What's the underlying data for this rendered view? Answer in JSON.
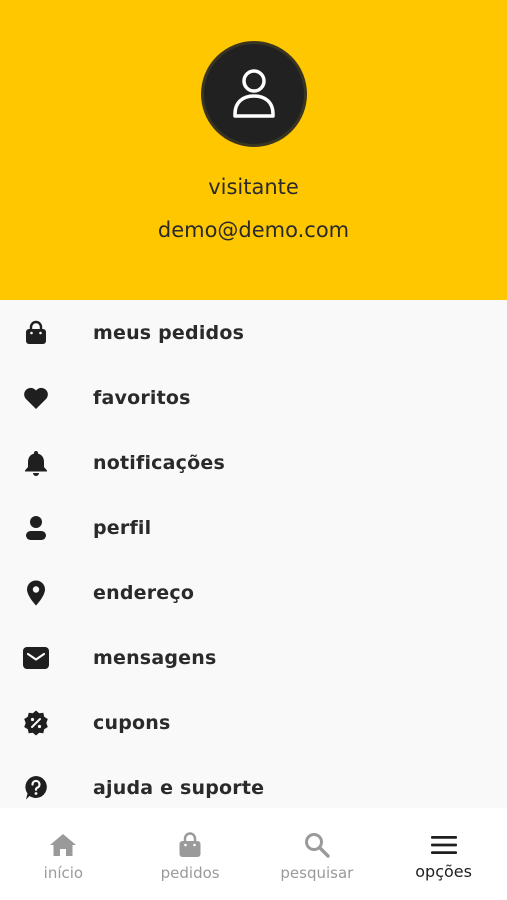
{
  "profile": {
    "name": "visitante",
    "email": "demo@demo.com"
  },
  "colors": {
    "header_bg": "#ffc700",
    "avatar_bg": "#212121",
    "text": "#2a2a2a",
    "nav_inactive": "#9a9a9a",
    "nav_active": "#1f1f1f"
  },
  "menu": {
    "items": [
      {
        "label": "meus pedidos",
        "icon": "shopping-bag-icon"
      },
      {
        "label": "favoritos",
        "icon": "heart-icon"
      },
      {
        "label": "notificações",
        "icon": "bell-icon"
      },
      {
        "label": "perfil",
        "icon": "person-icon"
      },
      {
        "label": "endereço",
        "icon": "location-pin-icon"
      },
      {
        "label": "mensagens",
        "icon": "mail-icon"
      },
      {
        "label": "cupons",
        "icon": "discount-badge-icon"
      },
      {
        "label": "ajuda e suporte",
        "icon": "help-icon"
      }
    ]
  },
  "bottom_nav": {
    "items": [
      {
        "label": "início",
        "icon": "home-icon"
      },
      {
        "label": "pedidos",
        "icon": "shopping-bag-icon"
      },
      {
        "label": "pesquisar",
        "icon": "search-icon"
      },
      {
        "label": "opções",
        "icon": "menu-icon"
      }
    ],
    "active": "opções"
  }
}
